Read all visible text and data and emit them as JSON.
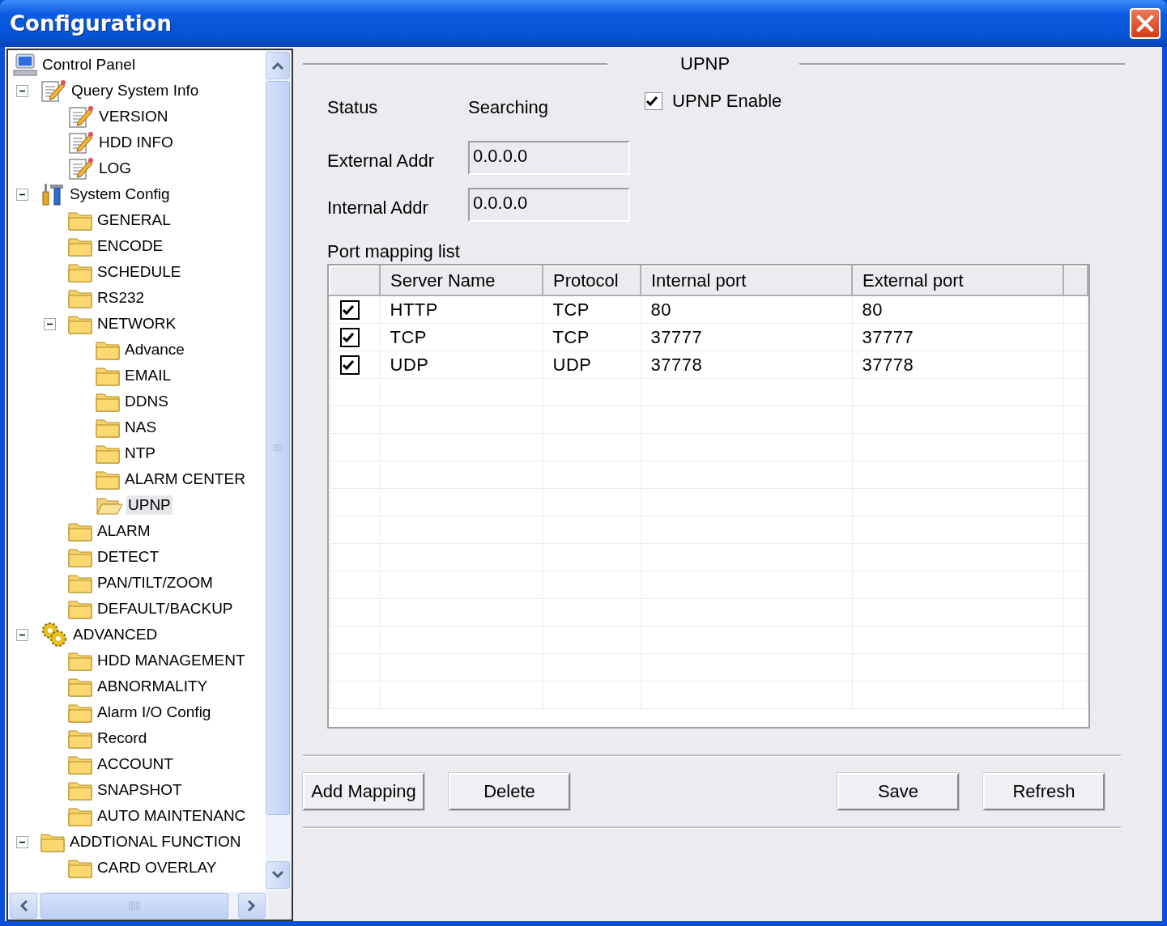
{
  "window": {
    "title": "Configuration"
  },
  "tree": {
    "label": "Control Panel",
    "kind": "computer",
    "selected": false,
    "children": [
      {
        "label": "Query System Info",
        "kind": "document",
        "selected": false,
        "expanded": true,
        "children": [
          {
            "label": "VERSION",
            "kind": "document",
            "selected": false
          },
          {
            "label": "HDD INFO",
            "kind": "document",
            "selected": false
          },
          {
            "label": "LOG",
            "kind": "document",
            "selected": false
          }
        ]
      },
      {
        "label": "System Config",
        "kind": "tools",
        "selected": false,
        "expanded": true,
        "children": [
          {
            "label": "GENERAL",
            "kind": "folder",
            "selected": false
          },
          {
            "label": "ENCODE",
            "kind": "folder",
            "selected": false
          },
          {
            "label": "SCHEDULE",
            "kind": "folder",
            "selected": false
          },
          {
            "label": "RS232",
            "kind": "folder",
            "selected": false
          },
          {
            "label": "NETWORK",
            "kind": "folder",
            "selected": false,
            "expanded": true,
            "children": [
              {
                "label": "Advance",
                "kind": "folder",
                "selected": false
              },
              {
                "label": "EMAIL",
                "kind": "folder",
                "selected": false
              },
              {
                "label": "DDNS",
                "kind": "folder",
                "selected": false
              },
              {
                "label": "NAS",
                "kind": "folder",
                "selected": false
              },
              {
                "label": "NTP",
                "kind": "folder",
                "selected": false
              },
              {
                "label": "ALARM CENTER",
                "kind": "folder",
                "selected": false
              },
              {
                "label": "UPNP",
                "kind": "folder",
                "selected": true
              }
            ]
          },
          {
            "label": "ALARM",
            "kind": "folder",
            "selected": false
          },
          {
            "label": "DETECT",
            "kind": "folder",
            "selected": false
          },
          {
            "label": "PAN/TILT/ZOOM",
            "kind": "folder",
            "selected": false
          },
          {
            "label": "DEFAULT/BACKUP",
            "kind": "folder",
            "selected": false
          }
        ]
      },
      {
        "label": "ADVANCED",
        "kind": "gears",
        "selected": false,
        "expanded": true,
        "children": [
          {
            "label": "HDD MANAGEMENT",
            "kind": "folder",
            "selected": false
          },
          {
            "label": "ABNORMALITY",
            "kind": "folder",
            "selected": false
          },
          {
            "label": "Alarm I/O Config",
            "kind": "folder",
            "selected": false
          },
          {
            "label": "Record",
            "kind": "folder",
            "selected": false
          },
          {
            "label": "ACCOUNT",
            "kind": "folder",
            "selected": false
          },
          {
            "label": "SNAPSHOT",
            "kind": "folder",
            "selected": false
          },
          {
            "label": "AUTO MAINTENANC",
            "kind": "folder",
            "selected": false
          }
        ]
      },
      {
        "label": "ADDTIONAL FUNCTION",
        "kind": "folder",
        "selected": false,
        "expanded": true,
        "children": [
          {
            "label": "CARD OVERLAY",
            "kind": "folder",
            "selected": false
          }
        ]
      }
    ]
  },
  "panel": {
    "group_title": "UPNP",
    "status": {
      "label": "Status",
      "value": "Searching"
    },
    "upnp_enable": {
      "label": "UPNP Enable",
      "checked": true
    },
    "fields": [
      {
        "label": "External Addr",
        "value": "0.0.0.0"
      },
      {
        "label": "Internal Addr",
        "value": "0.0.0.0"
      }
    ],
    "port_mapping": {
      "label": "Port mapping list",
      "columns": [
        "Server Name",
        "Protocol",
        "Internal port",
        "External port"
      ],
      "rows": [
        {
          "checked": true,
          "cells": [
            "HTTP",
            "TCP",
            "80",
            "80"
          ]
        },
        {
          "checked": true,
          "cells": [
            "TCP",
            "TCP",
            "37777",
            "37777"
          ]
        },
        {
          "checked": true,
          "cells": [
            "UDP",
            "UDP",
            "37778",
            "37778"
          ]
        }
      ]
    },
    "buttons": {
      "left": [
        "Add Mapping",
        "Delete"
      ],
      "right": [
        "Save",
        "Refresh"
      ]
    }
  }
}
